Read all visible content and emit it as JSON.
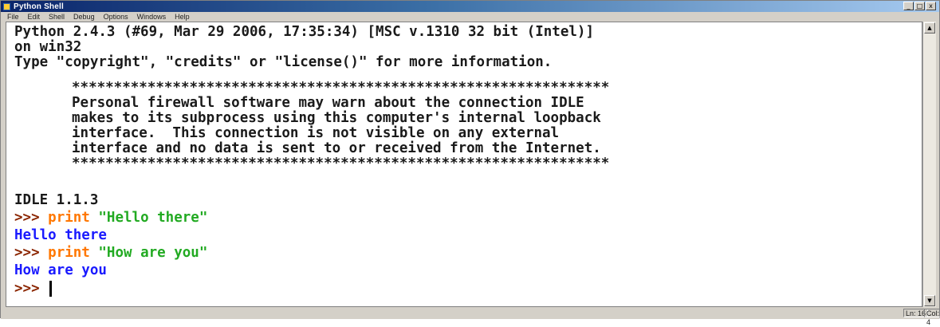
{
  "window": {
    "title": "Python Shell",
    "controls": {
      "minimize": "_",
      "maximize": "□",
      "close": "x"
    }
  },
  "menubar": {
    "items": [
      "File",
      "Edit",
      "Shell",
      "Debug",
      "Options",
      "Windows",
      "Help"
    ]
  },
  "shell": {
    "banner": [
      "Python 2.4.3 (#69, Mar 29 2006, 17:35:34) [MSC v.1310 32 bit (Intel)]",
      "on win32",
      "Type \"copyright\", \"credits\" or \"license()\" for more information."
    ],
    "firewall_notice": [
      "****************************************************************",
      "Personal firewall software may warn about the connection IDLE",
      "makes to its subprocess using this computer's internal loopback",
      "interface.  This connection is not visible on any external",
      "interface and no data is sent to or received from the Internet.",
      "****************************************************************"
    ],
    "idle_version": "IDLE 1.1.3",
    "prompt": ">>>",
    "session": [
      {
        "keyword": "print",
        "string": "\"Hello there\"",
        "output": "Hello there"
      },
      {
        "keyword": "print",
        "string": "\"How are you\"",
        "output": "How are you"
      }
    ]
  },
  "statusbar": {
    "line": "Ln: 16",
    "col": "Col: 4"
  },
  "colors": {
    "prompt": "#8b2500",
    "keyword": "#ff7700",
    "string": "#22aa22",
    "output": "#1a1aff",
    "titlebar_start": "#0a246a"
  },
  "icons": {
    "title": "python-icon",
    "scroll_up": "arrow-up-icon",
    "scroll_down": "arrow-down-icon"
  }
}
